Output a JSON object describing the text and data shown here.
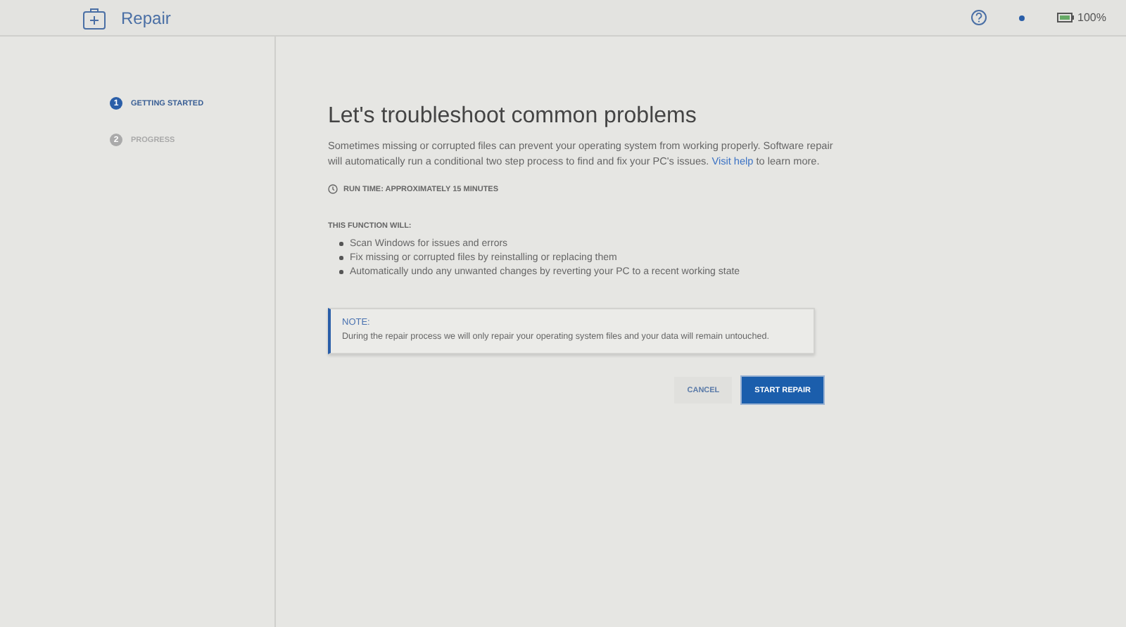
{
  "header": {
    "title": "Repair",
    "battery": "100%"
  },
  "steps": [
    {
      "number": "1",
      "label": "GETTING STARTED",
      "selected": true
    },
    {
      "number": "2",
      "label": "PROGRESS",
      "selected": false
    }
  ],
  "content": {
    "title": "Let's troubleshoot common problems",
    "intro": {
      "text": "Sometimes missing or corrupted files can prevent your operating system from working properly. Software repair will automatically run a conditional two step process to find and fix your PC's issues.",
      "link": "Visit help",
      "after": "to learn more."
    },
    "run_time": "RUN TIME: APPROXIMATELY 15 MINUTES",
    "list_heading": "THIS FUNCTION WILL:",
    "bullets": [
      "Scan Windows for issues and errors",
      "Fix missing or corrupted files by reinstalling or replacing them",
      "Automatically undo any unwanted changes by reverting your PC to a recent working state"
    ],
    "note": {
      "title": "NOTE:",
      "text": "During the repair process we will only repair your operating system files and your data will remain untouched."
    },
    "buttons": [
      {
        "label": "CANCEL",
        "kind": "secondary"
      },
      {
        "label": "START REPAIR",
        "kind": "primary"
      }
    ]
  }
}
